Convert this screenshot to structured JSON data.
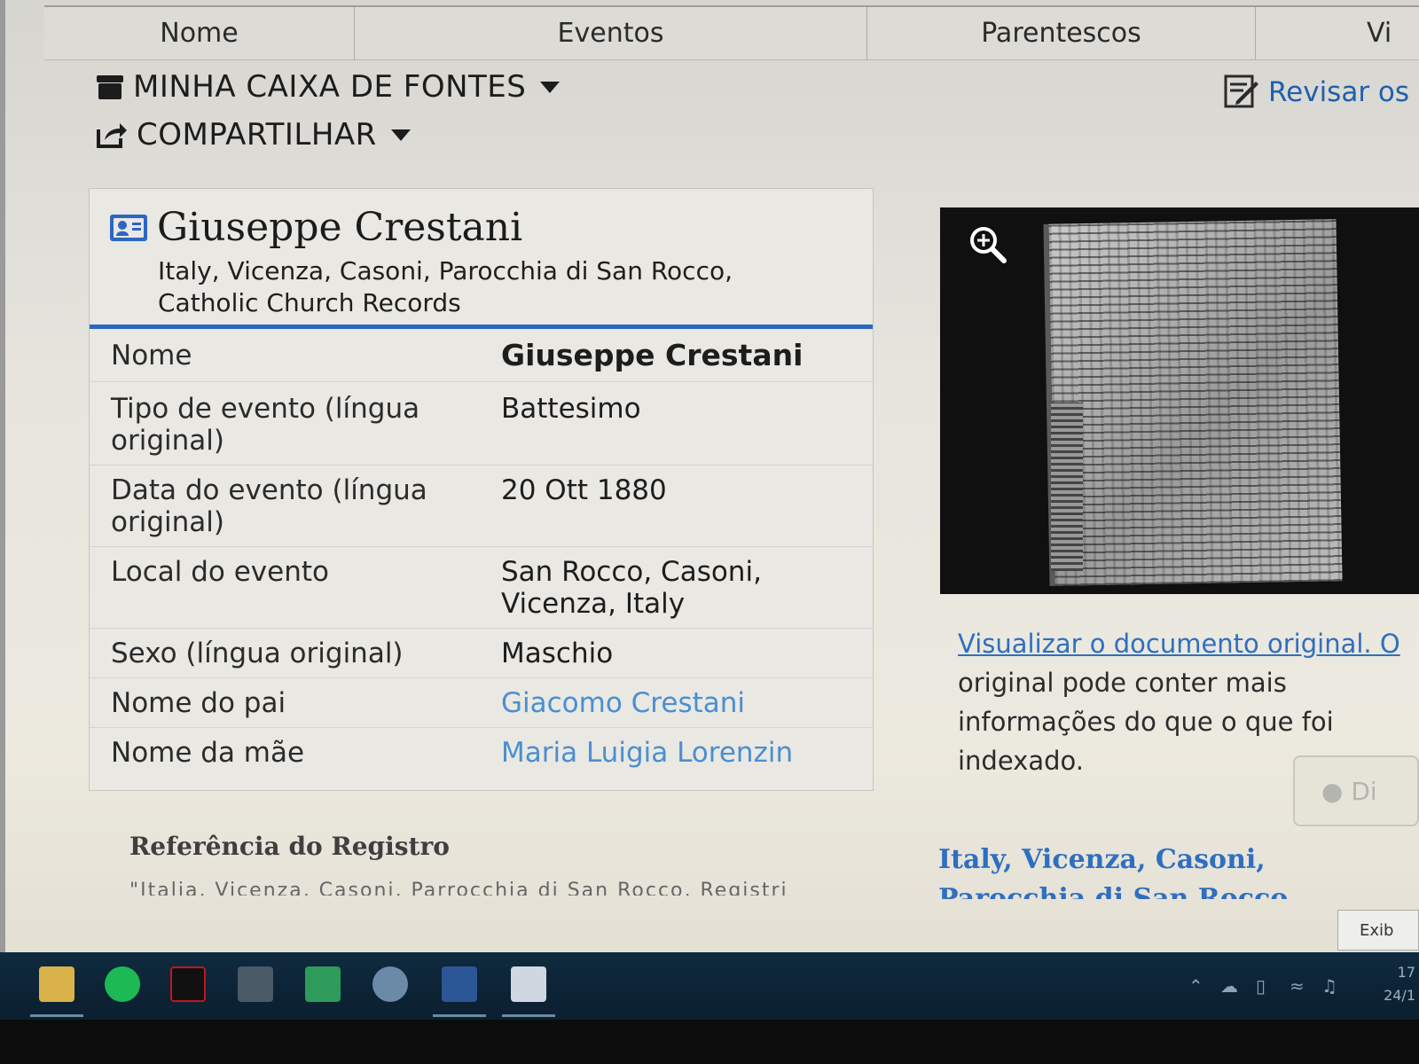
{
  "columns": [
    "Nome",
    "Eventos",
    "Parentescos",
    "Vi"
  ],
  "actions": {
    "source_box": "MINHA CAIXA DE FONTES",
    "share": "COMPARTILHAR",
    "review": "Revisar os"
  },
  "record": {
    "name": "Giuseppe Crestani",
    "collection": "Italy, Vicenza, Casoni, Parocchia di San Rocco, Catholic Church Records",
    "rows": [
      {
        "label": "Nome",
        "value": "Giuseppe Crestani"
      },
      {
        "label": "Tipo de evento (língua original)",
        "value": "Battesimo"
      },
      {
        "label": "Data do evento (língua original)",
        "value": "20 Ott 1880"
      },
      {
        "label": "Local do evento",
        "value": "San Rocco, Casoni, Vicenza, Italy"
      },
      {
        "label": "Sexo (língua original)",
        "value": "Maschio"
      },
      {
        "label": "Nome do pai",
        "value": "Giacomo Crestani"
      },
      {
        "label": "Nome da mãe",
        "value": "Maria Luigia Lorenzin"
      }
    ]
  },
  "reference": {
    "title": "Referência do Registro",
    "text": "\"Italia, Vicenza, Casoni, Parrocchia di San Rocco, Registri"
  },
  "viewer": {
    "link": "Visualizar o documento original.",
    "link_tail": " O",
    "description": "original pode conter mais informações do que o que foi indexado.",
    "tip_button": "Di"
  },
  "collection_link": "Italy, Vicenza, Casoni, Parocchia di San Rocco, Catholic Church",
  "exib_button": "Exib",
  "clock": {
    "time": "17",
    "date": "24/1"
  },
  "colors": {
    "accent": "#2c66c3",
    "link": "#2f6fc0",
    "taskbar": "#0f2a3f"
  }
}
